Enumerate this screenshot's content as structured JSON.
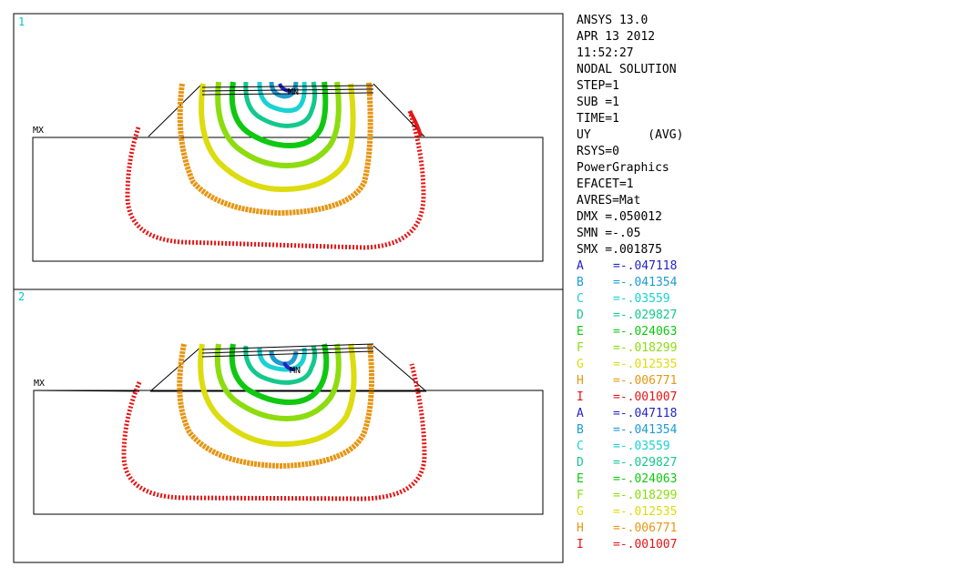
{
  "viewports": [
    {
      "number": "1",
      "max_label": "MX",
      "min_label": "MN"
    },
    {
      "number": "2",
      "max_label": "MX",
      "min_label": "MN"
    }
  ],
  "info_lines": [
    "ANSYS 13.0",
    "APR 13 2012",
    "11:52:27",
    "NODAL SOLUTION",
    "STEP=1",
    "SUB =1",
    "TIME=1",
    "UY        (AVG)",
    "RSYS=0",
    "PowerGraphics",
    "EFACET=1",
    "AVRES=Mat",
    "DMX =.050012",
    "SMN =-.05",
    "SMX =.001875"
  ],
  "legend": [
    {
      "letter": "A",
      "value": "=-.047118",
      "color": "#2323c8"
    },
    {
      "letter": "B",
      "value": "=-.041354",
      "color": "#1e9bd2"
    },
    {
      "letter": "C",
      "value": "=-.03559",
      "color": "#19d2d2"
    },
    {
      "letter": "D",
      "value": "=-.029827",
      "color": "#14c88c"
    },
    {
      "letter": "E",
      "value": "=-.024063",
      "color": "#0fc80f"
    },
    {
      "letter": "F",
      "value": "=-.018299",
      "color": "#8cdc0f"
    },
    {
      "letter": "G",
      "value": "=-.012535",
      "color": "#dcdc0f"
    },
    {
      "letter": "H",
      "value": "=-.006771",
      "color": "#e69614"
    },
    {
      "letter": "I",
      "value": "=-.001007",
      "color": "#e61414"
    },
    {
      "letter": "A",
      "value": "=-.047118",
      "color": "#2323c8"
    },
    {
      "letter": "B",
      "value": "=-.041354",
      "color": "#1e9bd2"
    },
    {
      "letter": "C",
      "value": "=-.03559",
      "color": "#19d2d2"
    },
    {
      "letter": "D",
      "value": "=-.029827",
      "color": "#14c88c"
    },
    {
      "letter": "E",
      "value": "=-.024063",
      "color": "#0fc80f"
    },
    {
      "letter": "F",
      "value": "=-.018299",
      "color": "#8cdc0f"
    },
    {
      "letter": "G",
      "value": "=-.012535",
      "color": "#dcdc0f"
    },
    {
      "letter": "H",
      "value": "=-.006771",
      "color": "#e69614"
    },
    {
      "letter": "I",
      "value": "=-.001007",
      "color": "#e61414"
    }
  ],
  "colors": {
    "viewport_border": "#000000",
    "viewport_number": "#00c8c8",
    "background": "#ffffff"
  }
}
